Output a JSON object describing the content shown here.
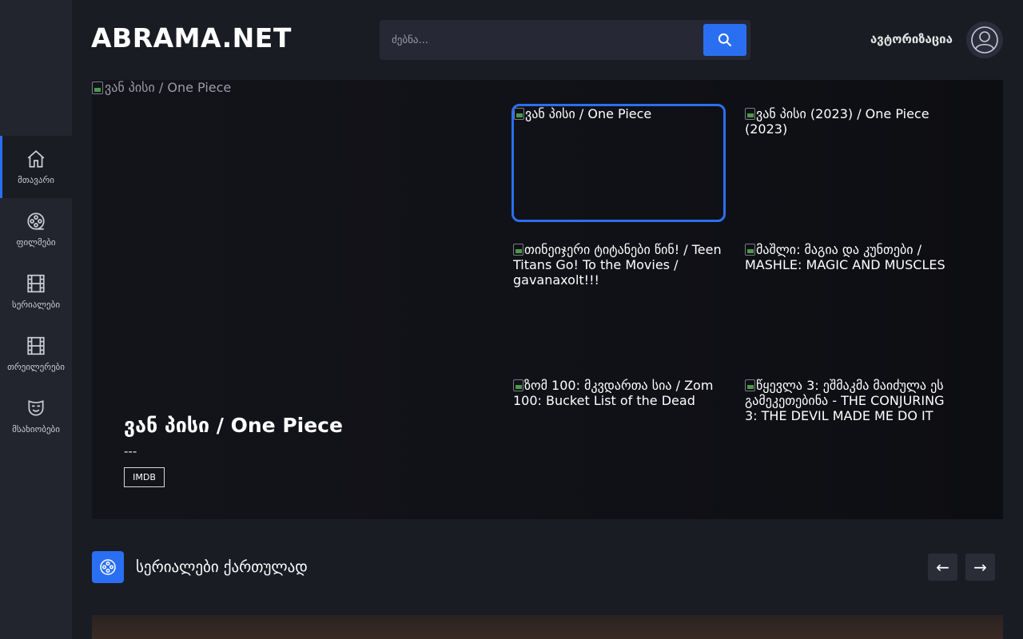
{
  "brand": {
    "logo": "ABRAMA.NET",
    "accent": "#2a6ff2"
  },
  "search": {
    "placeholder": "ძებნა..."
  },
  "header": {
    "auth_label": "ავტორიზაცია"
  },
  "nav": [
    {
      "label": "მთავარი",
      "icon": "home-icon",
      "active": true
    },
    {
      "label": "ფილმები",
      "icon": "film-reel-icon",
      "active": false
    },
    {
      "label": "სერიალები",
      "icon": "film-strip-icon",
      "active": false
    },
    {
      "label": "თრეილერები",
      "icon": "film-strip-icon",
      "active": false
    },
    {
      "label": "მსახიობები",
      "icon": "mask-icon",
      "active": false
    }
  ],
  "hero": {
    "image_alt": "ვან პისი / One Piece",
    "title": "ვან პისი / One Piece",
    "subtitle": "---",
    "badge": "IMDB"
  },
  "thumbs": [
    {
      "alt": "ვან პისი / One Piece",
      "active": true
    },
    {
      "alt": "ვან პისი (2023) / One Piece (2023)",
      "active": false
    },
    {
      "alt": "თინეიჯერი ტიტანები წინ! / Teen Titans Go! To the Movies / gavanaxolt!!!",
      "active": false
    },
    {
      "alt": "მაშლი: მაგია და კუნთები / MASHLE: MAGIC AND MUSCLES",
      "active": false
    },
    {
      "alt": "ზომ 100: მკვდართა სია / Zom 100: Bucket List of the Dead",
      "active": false
    },
    {
      "alt": "წყევლა 3: ეშმაკმა მაიძულა ეს გამეკეთებინა - THE CONJURING 3: THE DEVIL MADE ME DO IT",
      "active": false
    }
  ],
  "section": {
    "title": "სერიალები ქართულად",
    "icon": "film-reel-icon",
    "prev_label": "←",
    "next_label": "→"
  }
}
